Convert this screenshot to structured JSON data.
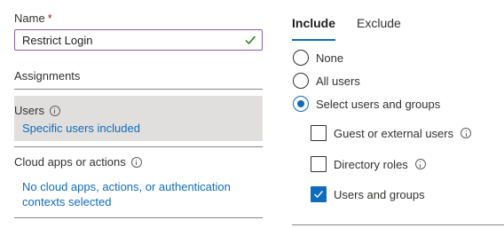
{
  "name_field": {
    "label": "Name",
    "required_mark": "*",
    "value": "Restrict Login",
    "valid_icon": "checkmark-icon"
  },
  "assignments": {
    "title": "Assignments",
    "users": {
      "label": "Users",
      "info_icon": "info-icon",
      "summary": "Specific users included"
    },
    "cloud_apps": {
      "label": "Cloud apps or actions",
      "info_icon": "info-icon",
      "summary": "No cloud apps, actions, or authentication contexts selected"
    }
  },
  "tabs": [
    {
      "label": "Include",
      "active": true
    },
    {
      "label": "Exclude",
      "active": false
    }
  ],
  "include_options": [
    {
      "label": "None",
      "selected": false
    },
    {
      "label": "All users",
      "selected": false
    },
    {
      "label": "Select users and groups",
      "selected": true
    }
  ],
  "select_options": [
    {
      "label": "Guest or external users",
      "checked": false,
      "has_info": true
    },
    {
      "label": "Directory roles",
      "checked": false,
      "has_info": true
    },
    {
      "label": "Users and groups",
      "checked": true,
      "has_info": false
    }
  ],
  "colors": {
    "accent": "#0f6cbd",
    "valid_green": "#107c10",
    "input_border": "#8a5fb0",
    "selected_bg": "#e1dfdd",
    "required_red": "#a4262c"
  }
}
